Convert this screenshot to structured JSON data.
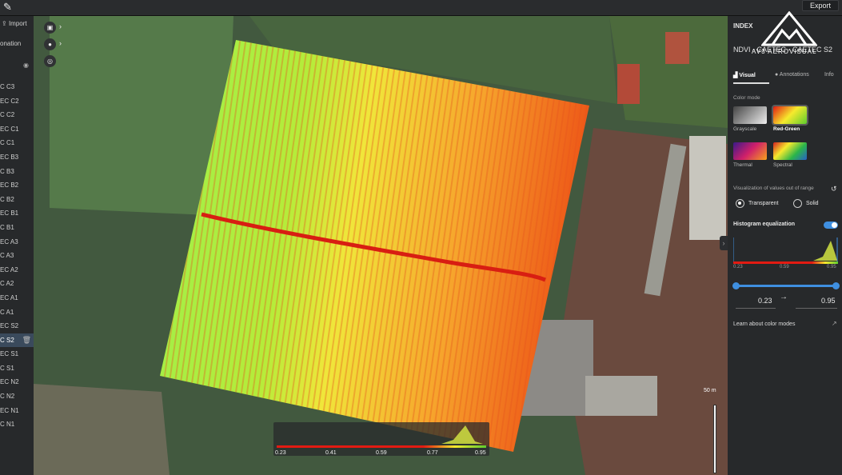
{
  "topbar": {
    "export_label": "Export",
    "edit_icon": "pencil-icon"
  },
  "left_panel": {
    "import_label": "Import",
    "annotation_label": "onation",
    "layers": [
      "C C3",
      "EC C2",
      "C C2",
      "EC C1",
      "C C1",
      "EC B3",
      "C B3",
      "EC B2",
      "C B2",
      "EC B1",
      "C B1",
      "EC A3",
      "C A3",
      "EC A2",
      "C A2",
      "EC A1",
      "C A1",
      "EC S2",
      "C S2",
      "EC S1",
      "C S1",
      "EC N2",
      "C N2",
      "EC N1",
      "C N1"
    ],
    "selected_layer": "C S2"
  },
  "map": {
    "scale_label": "50 m",
    "legend_ticks": [
      "0.23",
      "0.41",
      "0.59",
      "0.77",
      "0.95"
    ]
  },
  "right_panel": {
    "title": "INDEX",
    "logo_text": "AV3 AEROVISUAL",
    "layer_name": "NDVI - CAETEC - CAETEC S2",
    "tabs": [
      "Visual",
      "Annotations",
      "Info"
    ],
    "color_mode_label": "Color mode",
    "color_modes": [
      "Grayscale",
      "Red-Green",
      "Thermal",
      "Spectral"
    ],
    "selected_color_mode": "Red-Green",
    "out_of_range_label": "Visualization of values out of range",
    "out_of_range_options": [
      "Transparent",
      "Solid"
    ],
    "out_of_range_selected": "Transparent",
    "histogram_label": "Histogram equalization",
    "histogram_enabled": true,
    "hist_ticks": [
      "0.23",
      "0.59",
      "0.95"
    ],
    "range_min": "0.23",
    "range_max": "0.95",
    "learn_label": "Learn about color modes"
  },
  "colors": {
    "accent": "#3f8fe0",
    "ndvi_low": "#e21b12",
    "ndvi_mid": "#f6ea2d",
    "ndvi_high": "#5dcc2e"
  }
}
